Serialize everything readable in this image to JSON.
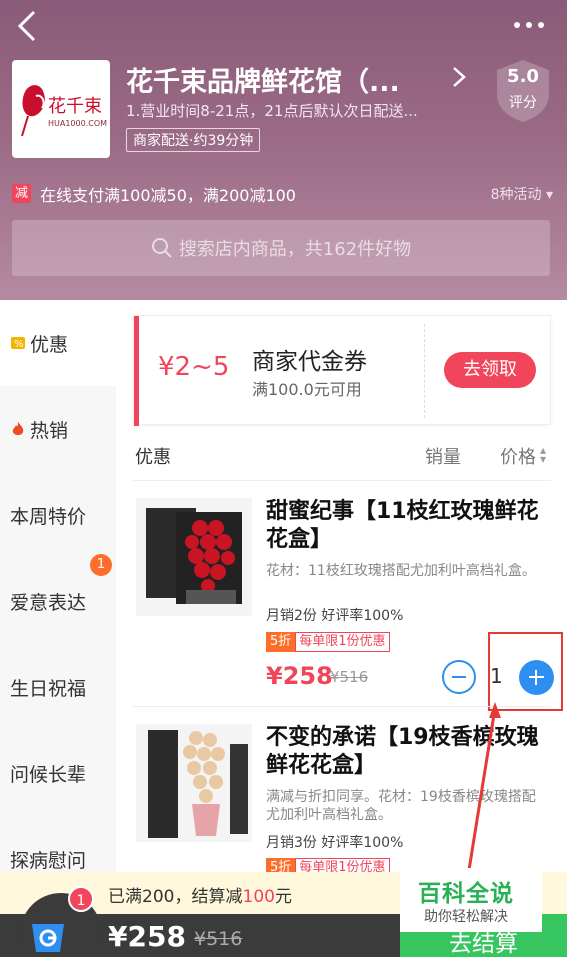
{
  "header": {
    "shop_name": "花千束品牌鲜花馆（...",
    "shop_desc": "1.营业时间8-21点，21点后默认次日配送...",
    "delivery_tag": "商家配送·约39分钟",
    "logo_text": "花千束",
    "logo_sub": "HUA1000.COM",
    "rating_score": "5.0",
    "rating_label": "评分",
    "promo_badge": "减",
    "promo_text": "在线支付满100减50，满200减100",
    "promo_count": "8种活动 ▾",
    "search_placeholder": "搜索店内商品，共162件好物"
  },
  "sidebar": {
    "items": [
      {
        "label": "优惠"
      },
      {
        "label": "热销"
      },
      {
        "label": "本周特价"
      },
      {
        "label": "爱意表达",
        "badge": "1"
      },
      {
        "label": "生日祝福"
      },
      {
        "label": "问候长辈"
      },
      {
        "label": "探病慰问"
      }
    ]
  },
  "coupon": {
    "amount": "¥2~5",
    "title": "商家代金券",
    "condition": "满100.0元可用",
    "button": "去领取"
  },
  "section": {
    "title": "优惠",
    "sort_sales": "销量",
    "sort_price": "价格"
  },
  "products": [
    {
      "name": "甜蜜纪事【11枝红玫瑰鲜花花盒】",
      "desc": "花材：11枝红玫瑰搭配尤加利叶高档礼盒。",
      "stats": "月销2份 好评率100%",
      "tag_a": "5折",
      "tag_b": "每单限1份优惠",
      "price": "¥258",
      "old_price": "¥516",
      "qty": "1"
    },
    {
      "name": "不变的承诺【19枝香槟玫瑰鲜花花盒】",
      "desc": "满减与折扣同享。花材：19枝香槟玫瑰搭配尤加利叶高档礼盒。",
      "stats": "月销3份 好评率100%",
      "tag_a": "5折",
      "tag_b": "每单限1份优惠"
    }
  ],
  "cart": {
    "notice_prefix": "已满200，结算减",
    "notice_amount": "100",
    "notice_suffix": "元",
    "badge": "1",
    "total": "¥258",
    "total_old": "¥516",
    "checkout": "去结算"
  },
  "watermark": {
    "title": "百科全说",
    "sub": "助你轻松解决"
  },
  "colors": {
    "accent": "#f0455a",
    "blue": "#2e8ff0",
    "green": "#37c560"
  }
}
